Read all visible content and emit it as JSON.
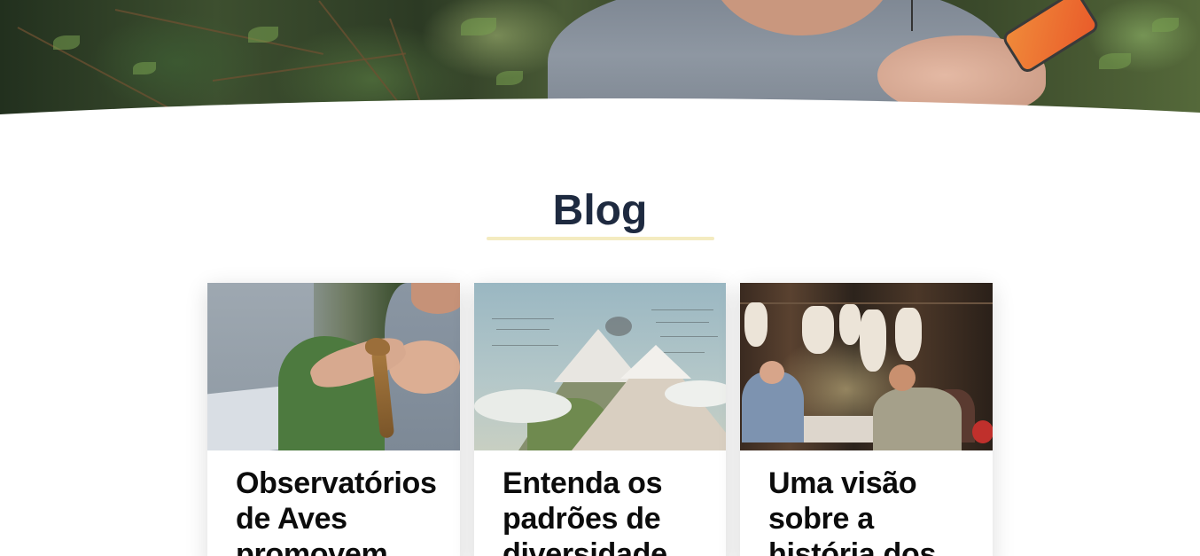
{
  "hero": {
    "image_alt": "Researcher in a forest holding an orange device"
  },
  "blog": {
    "heading": "Blog",
    "accent_color": "#f4ebc0",
    "heading_color": "#1e2a40"
  },
  "cards": [
    {
      "title": "Observatórios de Aves promovem",
      "image_alt": "Hands holding a small bird during banding"
    },
    {
      "title": "Entenda os padrões de diversidade",
      "image_alt": "Historic illustration of volcanic mountains"
    },
    {
      "title": "Uma visão sobre a história dos",
      "image_alt": "Researchers working at a table in a forest with bags hanging on a line"
    }
  ]
}
